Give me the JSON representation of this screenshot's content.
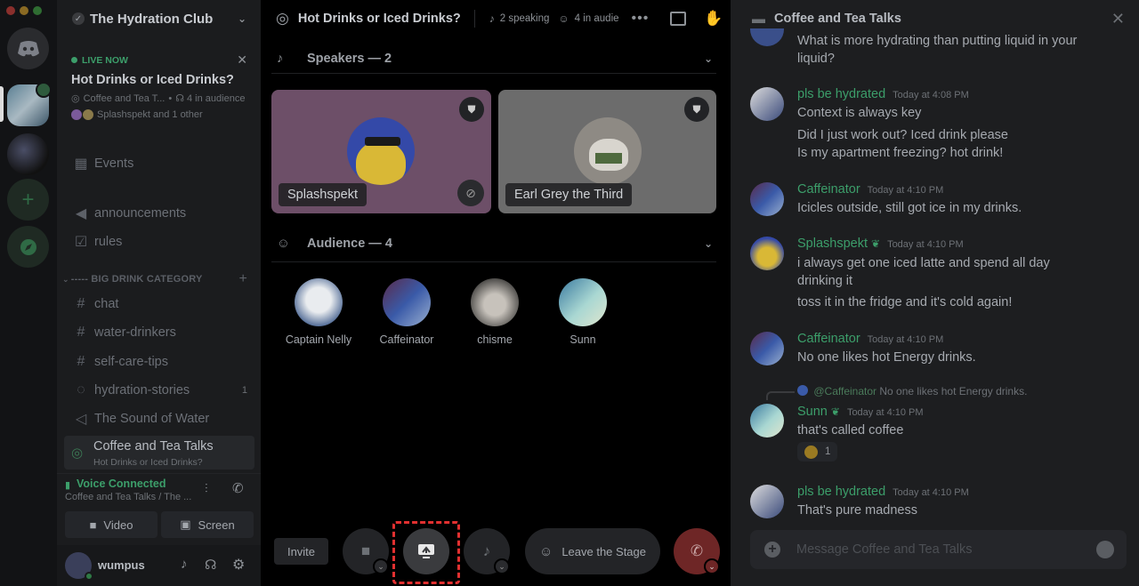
{
  "colors": {
    "accent_green": "#3c9e6a",
    "brand_blue": "#5865f2",
    "danger": "#7a2a2a",
    "selection": "#e23030",
    "live_green": "#4a9b5e"
  },
  "guild": {
    "name": "The Hydration Club"
  },
  "live": {
    "badge": "LIVE NOW",
    "title": "Hot Drinks or Iced Drinks?",
    "channel": "Coffee and Tea T...",
    "audience": "4 in audience",
    "speakers": "Splashspekt and 1 other"
  },
  "sidebar": {
    "events": "Events",
    "channels_top": [
      {
        "icon": "megaphone-icon",
        "label": "announcements"
      },
      {
        "icon": "rules-check-icon",
        "label": "rules"
      }
    ],
    "category": "----- BIG DRINK CATEGORY",
    "channels": [
      {
        "icon": "hash-icon",
        "label": "chat"
      },
      {
        "icon": "hash-icon",
        "label": "water-drinkers"
      },
      {
        "icon": "hash-icon",
        "label": "self-care-tips"
      },
      {
        "icon": "forum-icon",
        "label": "hydration-stories",
        "badge": "1"
      },
      {
        "icon": "speaker-icon",
        "label": "The Sound of Water"
      }
    ],
    "active_stage": {
      "label": "Coffee and Tea Talks",
      "sub": "Hot Drinks or Iced Drinks?"
    }
  },
  "voice": {
    "status": "Voice Connected",
    "location": "Coffee and Tea Talks / The ...",
    "video_label": "Video",
    "screen_label": "Screen"
  },
  "user": {
    "name": "wumpus"
  },
  "stage": {
    "title": "Hot Drinks or Iced Drinks?",
    "speaking": "2 speaking",
    "audience": "4 in audie",
    "speakers_header": "Speakers — 2",
    "audience_header": "Audience — 4",
    "speakers": [
      {
        "name": "Splashspekt"
      },
      {
        "name": "Earl Grey the Third"
      }
    ],
    "audience_members": [
      {
        "name": "Captain Nelly"
      },
      {
        "name": "Caffeinator"
      },
      {
        "name": "chisme"
      },
      {
        "name": "Sunn"
      }
    ],
    "invite_label": "Invite",
    "leave_label": "Leave the Stage"
  },
  "chat": {
    "title": "Coffee and Tea Talks",
    "top_lines": [
      "What is more hydrating than putting liquid in your",
      "liquid?"
    ],
    "messages": [
      {
        "user": "pls be hydrated",
        "time": "Today at 4:08 PM",
        "lines": [
          "Context is always key",
          "Did I just work out? Iced drink please",
          "Is my apartment freezing? hot drink!"
        ]
      },
      {
        "user": "Caffeinator",
        "time": "Today at 4:10 PM",
        "lines": [
          "Icicles outside, still got ice in my drinks."
        ]
      },
      {
        "user": "Splashspekt",
        "time": "Today at 4:10 PM",
        "lines": [
          "i always get one iced latte and spend all day",
          "drinking it",
          "toss it in the fridge and it's cold again!"
        ]
      },
      {
        "user": "Caffeinator",
        "time": "Today at 4:10 PM",
        "lines": [
          "No one likes hot Energy drinks."
        ]
      },
      {
        "user": "Sunn",
        "time": "Today at 4:10 PM",
        "reply_to": "@Caffeinator",
        "reply_text": "No one likes hot Energy drinks.",
        "lines": [
          "that's called coffee"
        ],
        "reaction_count": "1"
      },
      {
        "user": "pls be hydrated",
        "time": "Today at 4:10 PM",
        "lines": [
          "That's pure madness"
        ]
      }
    ],
    "placeholder": "Message Coffee and Tea Talks"
  }
}
